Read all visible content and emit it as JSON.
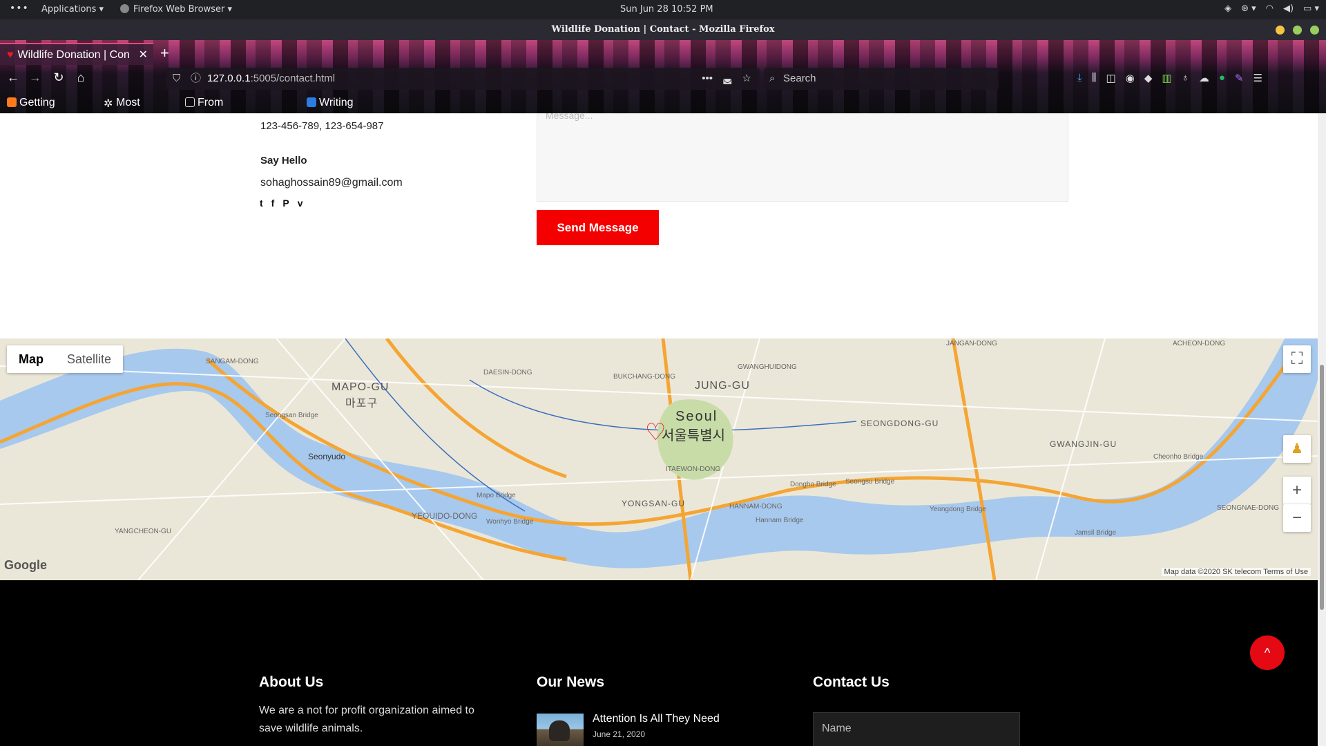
{
  "gnome": {
    "applications": "Applications",
    "firefox": "Firefox Web Browser",
    "clock": "Sun Jun 28  10:52 PM"
  },
  "window": {
    "title": "Wildlife Donation | Contact - Mozilla Firefox"
  },
  "tab": {
    "label": "Wildlife Donation | Con",
    "new_tab": "+"
  },
  "url": {
    "host": "127.0.0.1",
    "rest": ":5005/contact.html"
  },
  "search": {
    "placeholder": "Search"
  },
  "bookmarks": [
    {
      "label": "Getting Started"
    },
    {
      "label": "Most Visited"
    },
    {
      "label": "From Google Chrome"
    },
    {
      "label": "Writing READMEs - Ud..."
    }
  ],
  "contact": {
    "phones": "123-456-789, 123-654-987",
    "say_hello": "Say Hello",
    "email": "sohaghossain89@gmail.com",
    "social": [
      "t",
      "f",
      "P",
      "v"
    ],
    "message_placeholder": "Message...",
    "send_button": "Send Message"
  },
  "map": {
    "type_map": "Map",
    "type_satellite": "Satellite",
    "city_en": "Seoul",
    "city_ko": "서울특별시",
    "labels": [
      {
        "t": "SANGAM-DONG"
      },
      {
        "t": "MAPO-GU"
      },
      {
        "t": "마포구"
      },
      {
        "t": "JUNG-GU"
      },
      {
        "t": "SEONGDONG-GU"
      },
      {
        "t": "GWANGJIN-GU"
      },
      {
        "t": "Seonyudo"
      },
      {
        "t": "YEOUIDO-DONG"
      },
      {
        "t": "YONGSAN-GU"
      },
      {
        "t": "ITAEWON-DONG"
      },
      {
        "t": "Mapo Bridge"
      },
      {
        "t": "Dongho Bridge"
      },
      {
        "t": "Seongsu Bridge"
      },
      {
        "t": "Yeongdong Bridge"
      },
      {
        "t": "Cheonho Bridge"
      },
      {
        "t": "Hannam Bridge"
      },
      {
        "t": "Wonhyo Bridge"
      },
      {
        "t": "Jamsil Bridge"
      },
      {
        "t": "YANGCHEON-GU"
      },
      {
        "t": "JANGAN-DONG"
      },
      {
        "t": "ACHEON-DONG"
      },
      {
        "t": "GWANGHUIDONG"
      },
      {
        "t": "BUKCHANG-DONG"
      },
      {
        "t": "DAESIN-DONG"
      },
      {
        "t": "HANNAM-DONG"
      },
      {
        "t": "SEONGNAE-DONG"
      },
      {
        "t": "Seongsan Bridge"
      }
    ],
    "attribution": "Map data ©2020 SK telecom   Terms of Use",
    "google": "Google",
    "zoom_in": "+",
    "zoom_out": "−"
  },
  "footer": {
    "about_heading": "About Us",
    "about_text": "We are a not for profit organization aimed to save wildlife animals.",
    "news_heading": "Our News",
    "news_title": "Attention Is All They Need",
    "news_date": "June 21, 2020",
    "contact_heading": "Contact Us",
    "name_placeholder": "Name"
  },
  "colors": {
    "accent": "#f40000",
    "footer_bg": "#000000"
  }
}
